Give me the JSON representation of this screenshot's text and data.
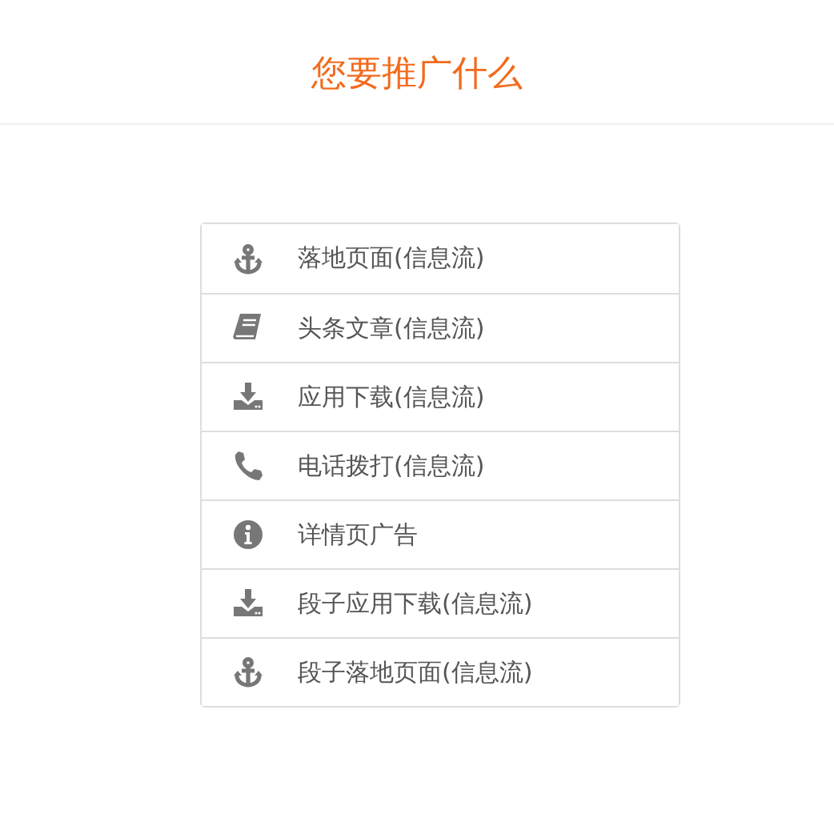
{
  "title": "您要推广什么",
  "options": [
    {
      "kind": "anchor",
      "label": "落地页面(信息流)"
    },
    {
      "kind": "book",
      "label": "头条文章(信息流)"
    },
    {
      "kind": "download",
      "label": "应用下载(信息流)"
    },
    {
      "kind": "phone",
      "label": "电话拨打(信息流)"
    },
    {
      "kind": "info",
      "label": "详情页广告"
    },
    {
      "kind": "download",
      "label": "段子应用下载(信息流)"
    },
    {
      "kind": "anchor",
      "label": "段子落地页面(信息流)"
    }
  ]
}
